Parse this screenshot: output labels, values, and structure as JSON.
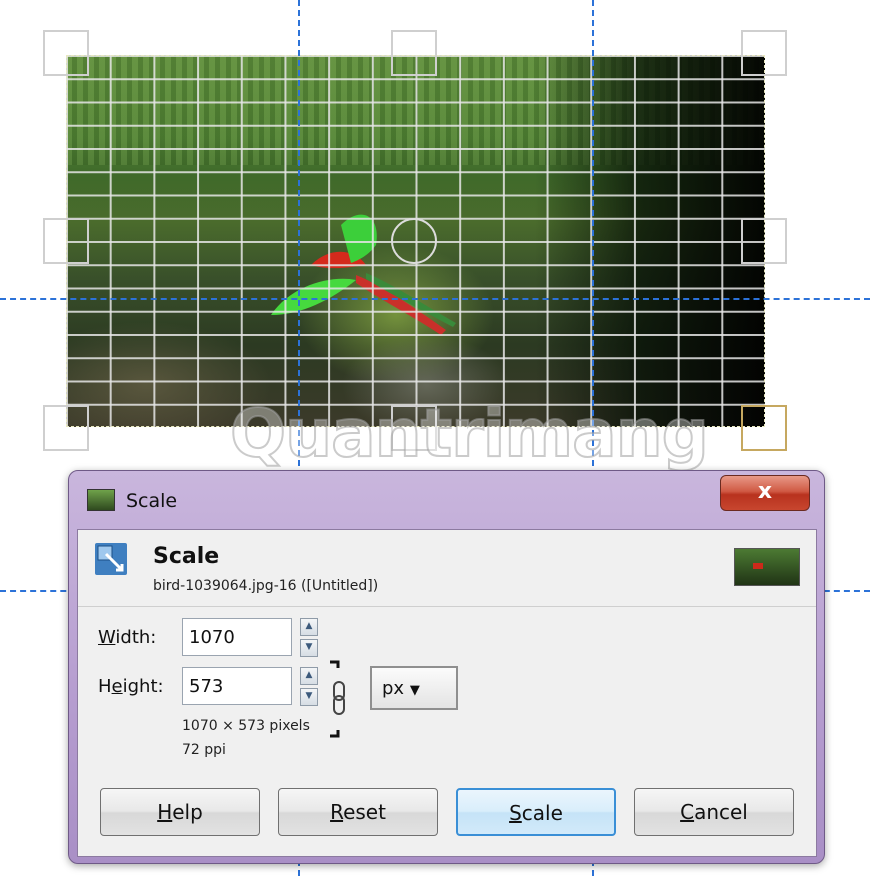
{
  "canvas": {
    "watermark": "Quantrimang",
    "handles": [
      "top-left",
      "top-center",
      "top-right",
      "middle-left",
      "middle-right",
      "bottom-left",
      "bottom-center",
      "bottom-right"
    ],
    "active_handle": "bottom-right"
  },
  "dialog": {
    "window_title": "Scale",
    "close_label": "x",
    "header": {
      "title": "Scale",
      "subtitle": "bird-1039064.jpg-16 ([Untitled])"
    },
    "width": {
      "label_pre": "",
      "label_u": "W",
      "label_post": "idth:",
      "value": "1070"
    },
    "height": {
      "label_pre": "H",
      "label_u": "e",
      "label_post": "ight:",
      "value": "573"
    },
    "unit": "px",
    "unit_arrow": "▼",
    "size_info": "1070 × 573 pixels",
    "resolution_info": "72 ppi",
    "buttons": {
      "help": {
        "u": "H",
        "rest": "elp"
      },
      "reset": {
        "u": "R",
        "rest": "eset"
      },
      "scale": {
        "u": "S",
        "rest": "cale"
      },
      "cancel": {
        "u": "C",
        "rest": "ancel"
      }
    },
    "spin_up": "▲",
    "spin_down": "▼"
  },
  "colors": {
    "guide": "#2c72d8",
    "accent_button": "#3a8fd6",
    "close": "#c8462f",
    "window_frame": "#b59ccf"
  }
}
